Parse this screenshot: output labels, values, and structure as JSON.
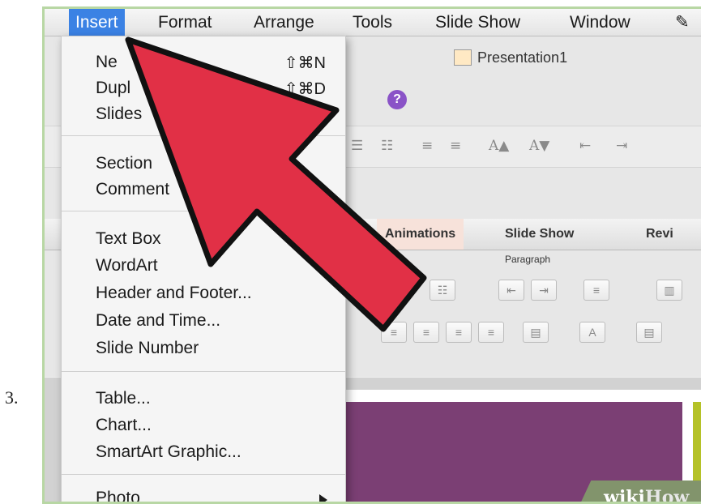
{
  "step_number": "3.",
  "menubar": {
    "items": [
      {
        "label": "Insert",
        "active": true
      },
      {
        "label": "Format"
      },
      {
        "label": "Arrange"
      },
      {
        "label": "Tools"
      },
      {
        "label": "Slide Show"
      },
      {
        "label": "Window"
      }
    ]
  },
  "document": {
    "title": "Presentation1"
  },
  "ribbon": {
    "tabs": [
      "Animations",
      "Slide Show",
      "Revi"
    ],
    "paragraph_label": "Paragraph",
    "font_size_glyphs": [
      "A▲",
      "A▼"
    ]
  },
  "insert_menu": {
    "items": [
      {
        "label": "Ne",
        "shortcut": "⇧⌘N"
      },
      {
        "label": "Dupl",
        "shortcut": "⇧⌘D"
      },
      {
        "label": "Slides"
      },
      {
        "label": "Section"
      },
      {
        "label": "Comment"
      },
      {
        "label": "Text Box"
      },
      {
        "label": "WordArt"
      },
      {
        "label": "Header and Footer..."
      },
      {
        "label": "Date and Time..."
      },
      {
        "label": "Slide Number"
      },
      {
        "label": "Table..."
      },
      {
        "label": "Chart..."
      },
      {
        "label": "SmartArt Graphic..."
      },
      {
        "label": "Photo",
        "has_submenu": true
      }
    ]
  },
  "watermark": {
    "text1": "wiki",
    "text2": "How"
  },
  "colors": {
    "menu_highlight": "#3b82e4",
    "arrow_fill": "#e13046",
    "slide_purple": "#7b3f74",
    "slide_accent": "#b5c228"
  }
}
